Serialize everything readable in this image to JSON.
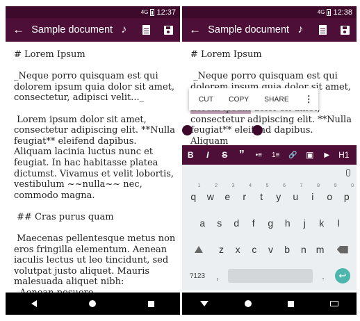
{
  "left": {
    "status_time": "12:37",
    "status_signal": "4G",
    "title": "Sample document",
    "doc_text": "# Lorem Ipsum\n\n_Neque porro quisquam est qui dolorem ipsum quia dolor sit amet, consectetur, adipisci velit..._\n\n Lorem ipsum dolor sit amet, consectetur adipiscing elit. **Nulla feugiat** eleifend dapibus. Aliquam lacinia luctus nunc et feugiat. In hac habitasse platea dictumst. Vivamus et velit lobortis, vestibulum ~~nulla~~ nec, commodo magna.\n\n ## Cras purus quam\n\n Maecenas pellentesque metus non eros fringilla elementum. Aenean iaculis lectus ut leo tincidunt, sed volutpat justo aliquet. Mauris malesuada aliquet nibh:\n  Aenean posuere"
  },
  "right": {
    "status_time": "12:38",
    "status_signal": "4G",
    "title": "Sample document",
    "doc_before": "# Lorem Ipsum\n\n _Neque porro quisquam est qui dolorem ipsum quia dolor sit amet,\n\n",
    "doc_selected": "Lorem ipsum",
    "doc_after": " dolor sit amet, consectetur adipiscing elit. **Nulla feugiat** eleifend dapibus. Aliquam",
    "context_menu": [
      "CUT",
      "COPY",
      "SHARE"
    ],
    "format_bar": [
      "B",
      "I",
      "S",
      "”",
      "•≡",
      "1≡",
      "🔗",
      "▣",
      "▶",
      "H1"
    ],
    "keyboard": {
      "row1": [
        "q",
        "w",
        "e",
        "r",
        "t",
        "y",
        "u",
        "i",
        "o",
        "p"
      ],
      "row1_hints": [
        "1",
        "2",
        "3",
        "4",
        "5",
        "6",
        "7",
        "8",
        "9",
        "0"
      ],
      "row2": [
        "a",
        "s",
        "d",
        "f",
        "g",
        "h",
        "j",
        "k",
        "l"
      ],
      "row3": [
        "z",
        "x",
        "c",
        "v",
        "b",
        "n",
        "m"
      ],
      "symbols": "?123",
      "comma": ",",
      "period": "."
    }
  },
  "colors": {
    "app_bar": "#4d0f37",
    "status_bar": "#3d0a2c",
    "selection": "#c7a6bd",
    "enter_key": "#4db6ac"
  },
  "icons": [
    "back-arrow-icon",
    "music-note-icon",
    "document-icon",
    "save-icon",
    "more-vert-icon",
    "mic-icon",
    "shift-icon",
    "backspace-icon",
    "enter-icon"
  ]
}
